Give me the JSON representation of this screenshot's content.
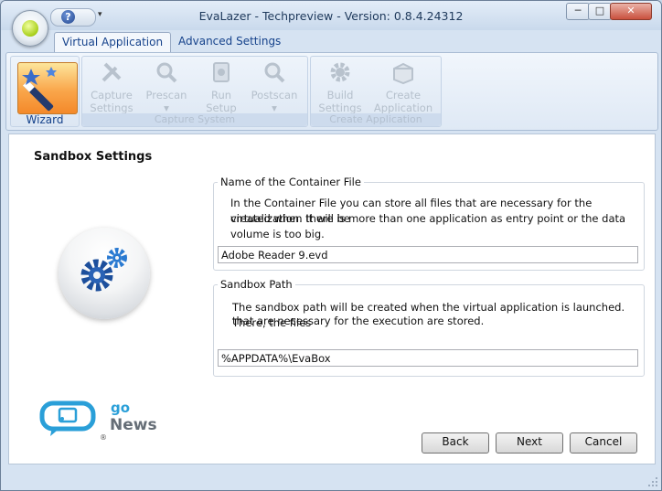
{
  "window": {
    "title": "EvaLazer - Techpreview - Version: 0.8.4.24312",
    "help_glyph": "?",
    "qat_dropdown_glyph": "▾",
    "minimize_glyph": "─",
    "maximize_glyph": "□",
    "close_glyph": "✕"
  },
  "tabs": [
    {
      "label": "Virtual Application"
    },
    {
      "label": "Advanced Settings"
    }
  ],
  "ribbon": {
    "wizard_label": "Wizard",
    "capture_system": {
      "group_label": "Capture System",
      "buttons": [
        {
          "label": "Capture\nSettings",
          "icon": "tools-icon"
        },
        {
          "label": "Prescan\n▾",
          "icon": "magnifier-icon"
        },
        {
          "label": "Run\nSetup",
          "icon": "setup-icon"
        },
        {
          "label": "Postscan\n▾",
          "icon": "magnifier-icon"
        }
      ]
    },
    "create_application": {
      "group_label": "Create Application",
      "buttons": [
        {
          "label": "Build\nSettings",
          "icon": "gear-icon"
        },
        {
          "label": "Create\nApplication",
          "icon": "box-icon"
        }
      ]
    }
  },
  "main": {
    "title": "Sandbox Settings",
    "container": {
      "legend": "Name of the Container File",
      "description_line1": "In the Container File you can store all files that are necessary for the virtualization. It will be",
      "description_line2": "created when there is more than one application as entry point or the data volume is too big.",
      "value": "Adobe Reader 9.evd"
    },
    "sandbox": {
      "legend": "Sandbox Path",
      "description_line1": "The sandbox path will be created when the virtual application is launched. There, the files",
      "description_line2": "that are necessary for the execution are stored.",
      "value": "%APPDATA%\\EvaBox"
    },
    "buttons": {
      "back": "Back",
      "next": "Next",
      "cancel": "Cancel"
    },
    "logo": {
      "go": "go",
      "news": "News",
      "reg": "®"
    }
  },
  "colors": {
    "accent": "#15428b",
    "wizard_orange": "#f4892a",
    "logo_blue": "#2a9fd8"
  }
}
